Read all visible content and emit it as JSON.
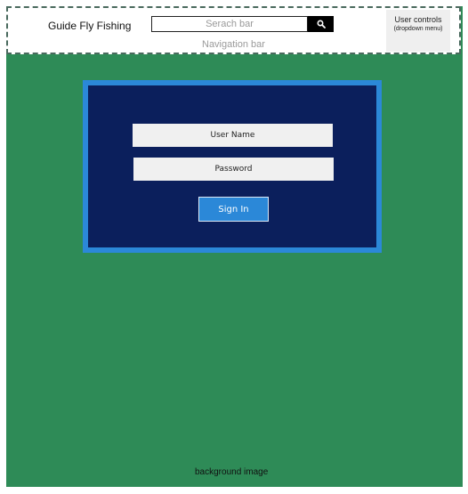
{
  "header": {
    "brand": "Guide Fly Fishing",
    "search": {
      "placeholder": "Serach bar",
      "button_icon": "search-icon"
    },
    "nav_caption": "Navigation bar",
    "user_controls": {
      "title": "User controls",
      "subtitle": "(dropdown menu)"
    }
  },
  "login": {
    "username_placeholder": "User Name",
    "password_placeholder": "Password",
    "sign_in_label": "Sign In"
  },
  "background_caption": "background image",
  "colors": {
    "background": "#2e8b57",
    "panel": "#0b1f5c",
    "panel_border": "#2b88d8",
    "button": "#2b88d8"
  }
}
